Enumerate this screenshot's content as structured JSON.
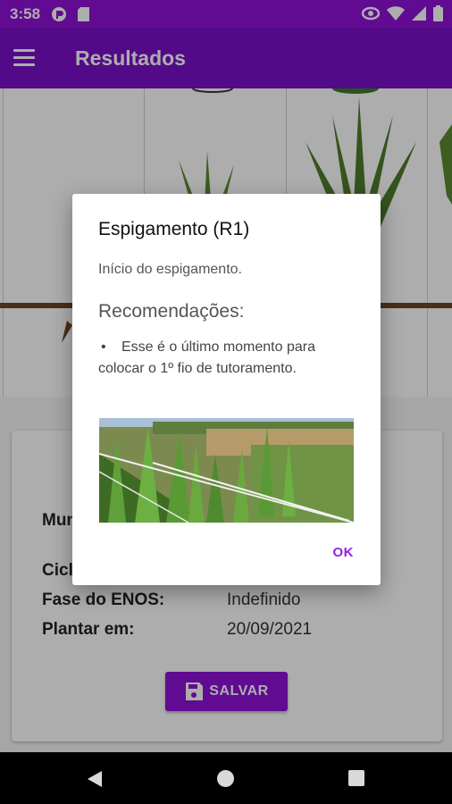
{
  "status_bar": {
    "time": "3:58",
    "icons": [
      "app-notification-icon",
      "sd-card-icon",
      "data-saver-icon",
      "wifi-icon",
      "signal-icon",
      "battery-icon"
    ]
  },
  "app_bar": {
    "title": "Resultados",
    "menu_icon": "hamburger-menu-icon"
  },
  "card": {
    "rows": [
      {
        "label": "Mun",
        "value": ""
      },
      {
        "label": "Cicl",
        "value": ""
      },
      {
        "label": "Fase do ENOS:",
        "value": "Indefinido"
      },
      {
        "label": "Plantar em:",
        "value": "20/09/2021"
      }
    ],
    "save_label": "SALVAR",
    "save_icon": "floppy-disk-icon"
  },
  "dialog": {
    "title": "Espigamento (R1)",
    "description": "Início do espigamento.",
    "recommendations_title": "Recomendações:",
    "bullet": "•",
    "recommendation": "Esse é o último momento para colocar o 1º fio de tutoramento.",
    "photo_icon": "gladiolus-field-photo",
    "ok_label": "OK"
  },
  "colors": {
    "primary": "#7b0fc9",
    "status_bar": "#8e11d6",
    "accent": "#9a1fe0"
  },
  "nav_bar": {
    "icons": [
      "back-icon",
      "home-icon",
      "recents-icon"
    ]
  }
}
